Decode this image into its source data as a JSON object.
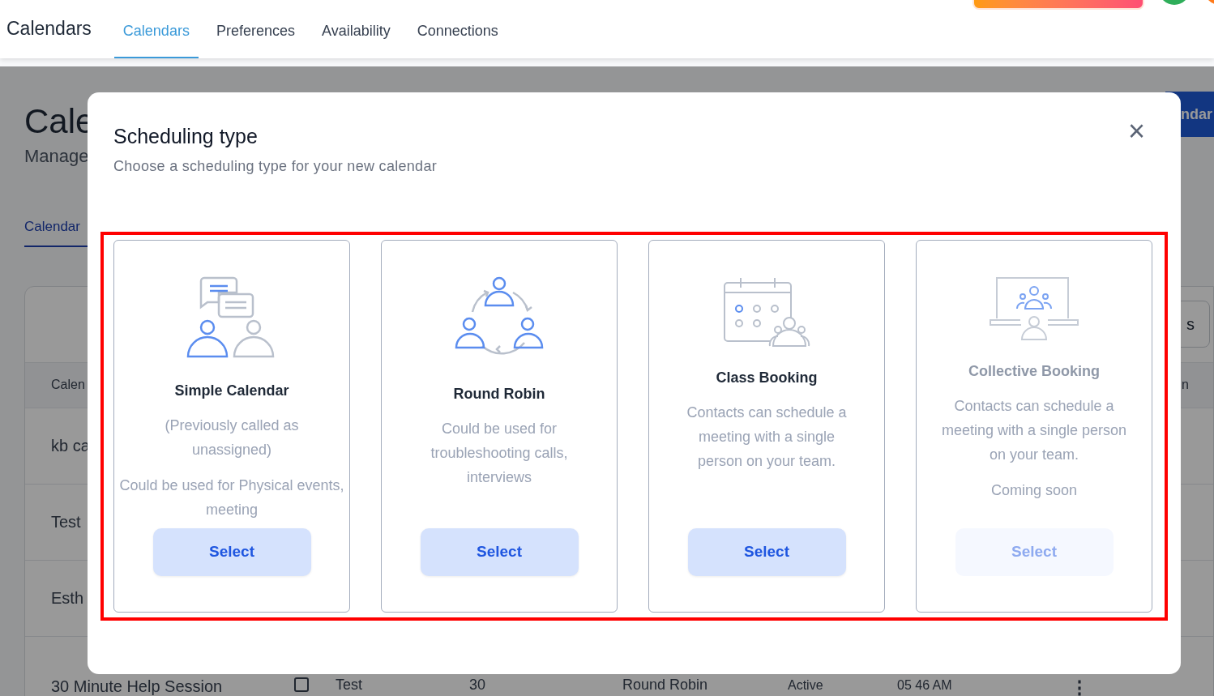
{
  "header": {
    "title": "Calendars",
    "tabs": [
      {
        "label": "Calendars",
        "selected": true
      },
      {
        "label": "Preferences",
        "selected": false
      },
      {
        "label": "Availability",
        "selected": false
      },
      {
        "label": "Connections",
        "selected": false
      }
    ]
  },
  "background": {
    "heading": "Cale",
    "subheading": "Manage",
    "tab": "Calendar",
    "new_button": "ndar",
    "toolbar_button": "s",
    "column_1": "Calen",
    "column_2": "n",
    "rows": [
      "kb ca",
      "Test",
      "Esth"
    ],
    "last_row": {
      "name": "30 Minute Help Session",
      "checked": false,
      "group": "Test",
      "duration": "30",
      "type": "Round Robin",
      "status": "Active",
      "date": "05 46 AM",
      "menu": "⋮"
    }
  },
  "modal": {
    "title": "Scheduling type",
    "subtitle": "Choose a scheduling type for your new calendar",
    "close": "×",
    "options": [
      {
        "title": "Simple Calendar",
        "description": [
          "(Previously called as unassigned)",
          "Could be used for Physical events, meeting"
        ],
        "button": "Select",
        "disabled": false
      },
      {
        "title": "Round Robin",
        "description": [
          "Could be used for troubleshooting calls, interviews"
        ],
        "button": "Select",
        "disabled": false
      },
      {
        "title": "Class Booking",
        "description": [
          "Contacts can schedule a meeting with a single person on your team."
        ],
        "button": "Select",
        "disabled": false
      },
      {
        "title": "Collective Booking",
        "description": [
          "Contacts can schedule a meeting with a single person on your team.",
          "Coming soon"
        ],
        "button": "Select",
        "disabled": true
      }
    ]
  }
}
